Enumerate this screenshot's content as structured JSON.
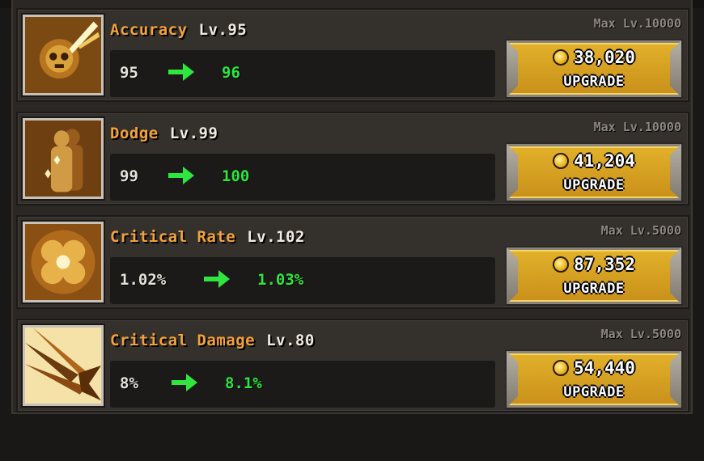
{
  "upgrades": [
    {
      "name": "Accuracy",
      "level": "Lv.95",
      "max_level": "Max Lv.10000",
      "current": "95",
      "next": "96",
      "cost": "38,020",
      "button": "UPGRADE",
      "icon": "skull-slash-icon"
    },
    {
      "name": "Dodge",
      "level": "Lv.99",
      "max_level": "Max Lv.10000",
      "current": "99",
      "next": "100",
      "cost": "41,204",
      "button": "UPGRADE",
      "icon": "afterimage-figure-icon"
    },
    {
      "name": "Critical Rate",
      "level": "Lv.102",
      "max_level": "Max Lv.5000",
      "current": "1.02%",
      "next": "1.03%",
      "cost": "87,352",
      "button": "UPGRADE",
      "icon": "clover-icon"
    },
    {
      "name": "Critical Damage",
      "level": "Lv.80",
      "max_level": "Max Lv.5000",
      "current": "8%",
      "next": "8.1%",
      "cost": "54,440",
      "button": "UPGRADE",
      "icon": "impact-burst-icon"
    }
  ],
  "colors": {
    "name": "#f3a23a",
    "next_value": "#2ee63e",
    "button_gold": "#e2b12a"
  }
}
